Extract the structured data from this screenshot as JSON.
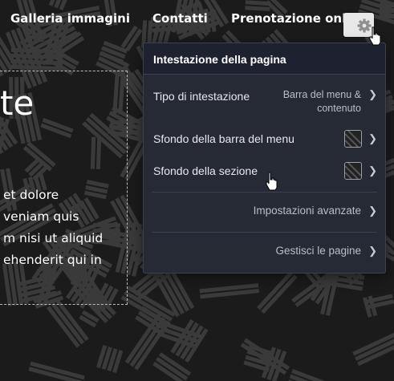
{
  "nav": {
    "items": [
      {
        "label": "Galleria immagini"
      },
      {
        "label": "Contatti"
      },
      {
        "label": "Prenotazione online"
      }
    ]
  },
  "hero": {
    "heading_fragment": "te",
    "text_lines": [
      "et dolore",
      "veniam quis",
      "m nisi ut aliquid",
      "ehenderit qui in"
    ]
  },
  "panel": {
    "title": "Intestazione della pagina",
    "rows": [
      {
        "label": "Tipo di intestazione",
        "value_line1": "Barra del menu &",
        "value_line2": "contenuto"
      },
      {
        "label": "Sfondo della barra del menu"
      },
      {
        "label": "Sfondo della sezione"
      }
    ],
    "links": [
      {
        "label": "Impostazioni avanzate"
      },
      {
        "label": "Gestisci le pagine"
      }
    ]
  },
  "icons": {
    "settings": "gear-icon",
    "chevron": "chevron-right-icon",
    "cursor": "hand-pointer-icon"
  },
  "colors": {
    "panel_bg": "#252a35",
    "panel_header_bg": "#1e2230",
    "page_bg": "#1b1b1b",
    "gear_button_bg": "#e8e8e8"
  }
}
